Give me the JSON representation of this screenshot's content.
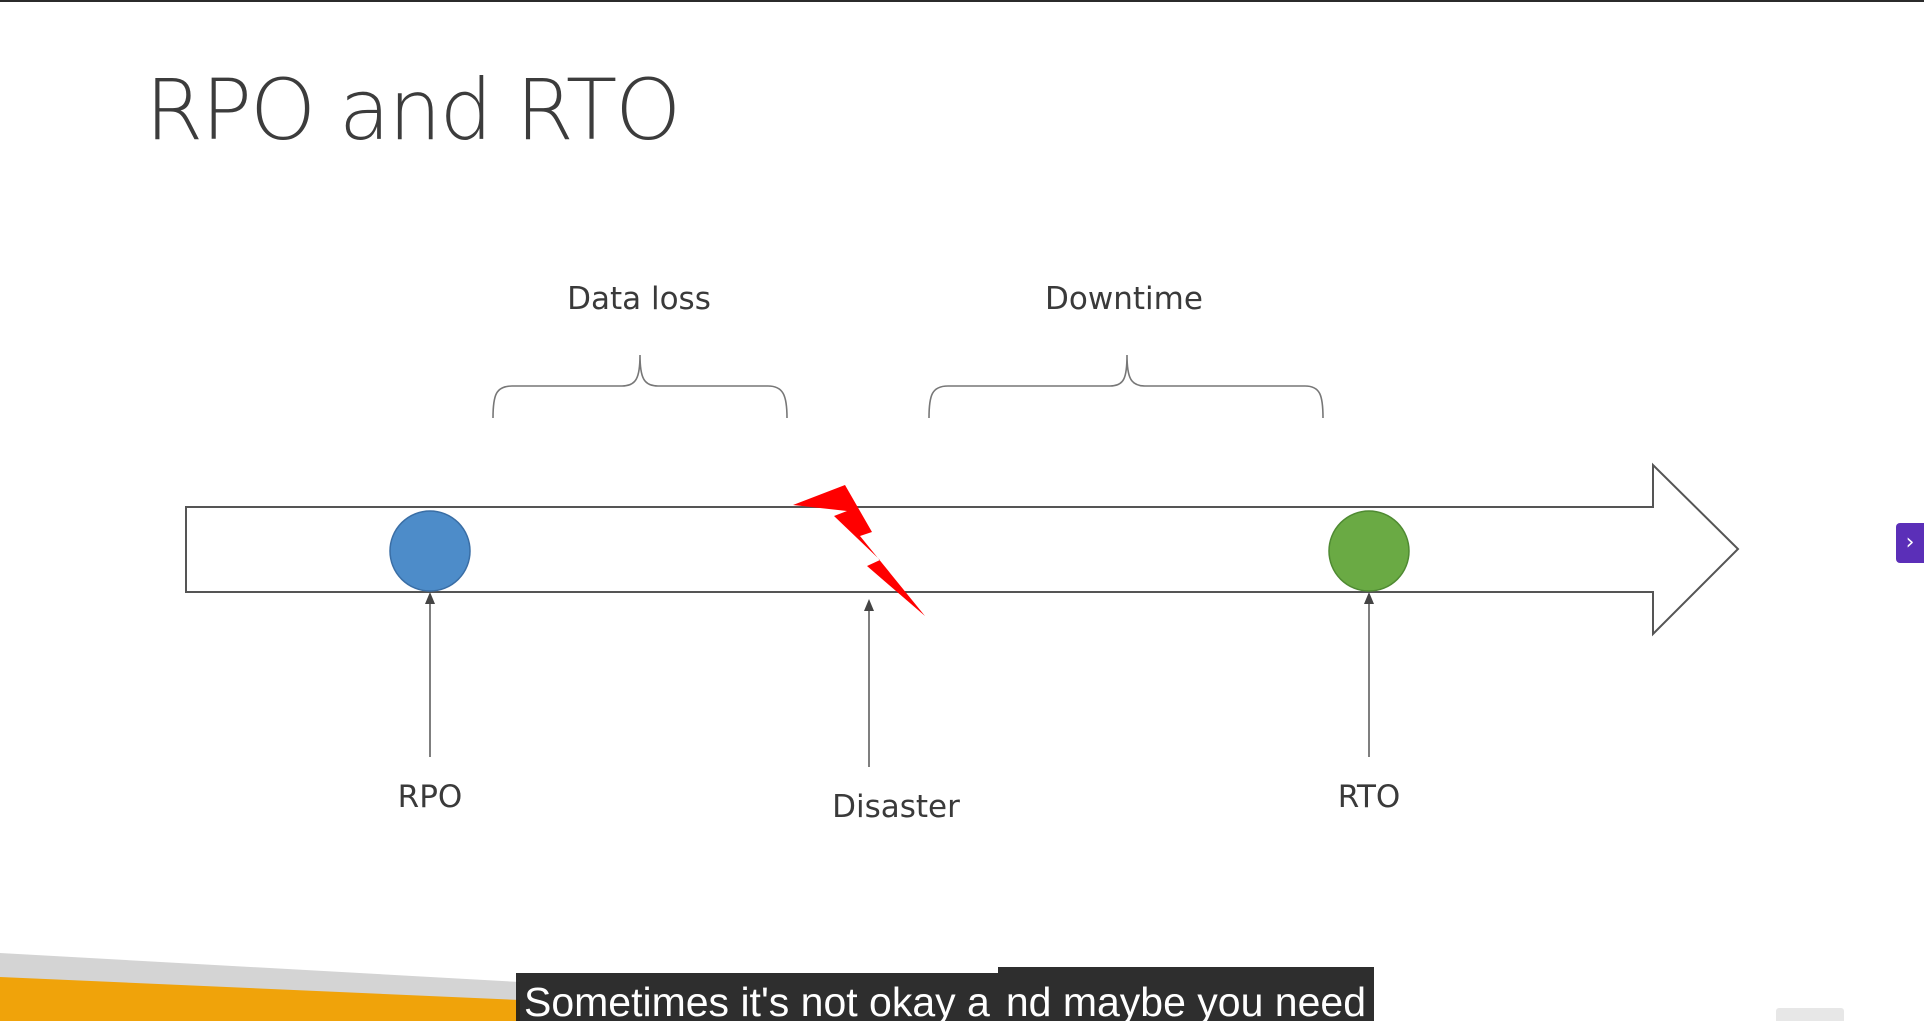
{
  "slide": {
    "title": "RPO and RTO"
  },
  "diagram": {
    "brace_labels": {
      "data_loss": "Data loss",
      "downtime": "Downtime"
    },
    "markers": {
      "rpo": "RPO",
      "disaster": "Disaster",
      "rto": "RTO"
    }
  },
  "navigation": {
    "next_icon": "chevron-right-icon",
    "next_glyph": "›"
  },
  "captions": {
    "part1": "Sometimes it's not okay a",
    "part2": "nd maybe you need"
  },
  "colors": {
    "rpo_circle": "#4d8cc9",
    "rto_circle": "#6aaa44",
    "disaster_bolt": "#ff0000",
    "accent_stripe": "#f0a30a",
    "nav_button": "#5b2fb8"
  }
}
